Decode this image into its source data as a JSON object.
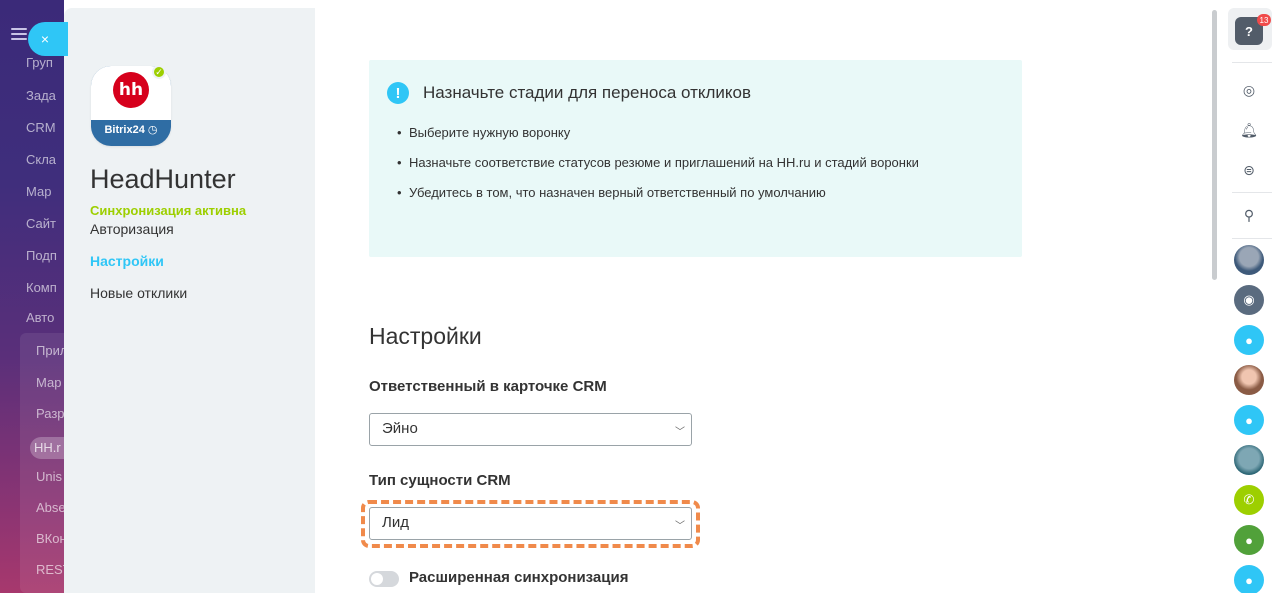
{
  "portal_menu": {
    "items": [
      {
        "label": "Груп",
        "active": false
      },
      {
        "label": "Зада",
        "active": false
      },
      {
        "label": "CRM",
        "active": false
      },
      {
        "label": "Скла",
        "active": false
      },
      {
        "label": "Мар",
        "active": false
      },
      {
        "label": "Сайт",
        "active": false
      },
      {
        "label": "Подп",
        "active": false
      },
      {
        "label": "Комп",
        "active": false
      },
      {
        "label": "Авто",
        "active": false
      },
      {
        "label": "Прил",
        "active": false
      },
      {
        "label": "Мар",
        "active": false
      },
      {
        "label": "Разр",
        "active": false
      },
      {
        "label": "HH.r",
        "active": true
      },
      {
        "label": "Unis",
        "active": false
      },
      {
        "label": "Abse",
        "active": false
      },
      {
        "label": "ВКон",
        "active": false
      },
      {
        "label": "REST",
        "active": false
      }
    ]
  },
  "slider": {
    "close_icon": "×"
  },
  "app_nav": {
    "logo_text": "hh",
    "logo_brand": "Bitrix24",
    "app_title": "HeadHunter",
    "sync_status": "Синхронизация активна",
    "links": [
      {
        "label": "Авторизация",
        "active": false
      },
      {
        "label": "Настройки",
        "active": true
      },
      {
        "label": "Новые отклики",
        "active": false
      }
    ]
  },
  "notice": {
    "icon": "!",
    "title": "Назначьте стадии для переноса откликов",
    "bullets": [
      "Выберите нужную воронку",
      "Назначьте соответствие статусов резюме и приглашений на HH.ru и стадий воронки",
      "Убедитесь в том, что назначен верный ответственный по умолчанию"
    ]
  },
  "settings": {
    "title": "Настройки",
    "responsible_label": "Ответственный в карточке CRM",
    "responsible_value": "Эйно",
    "entity_label": "Тип сущности CRM",
    "entity_value": "Лид",
    "advanced_sync_label": "Расширенная синхронизация",
    "advanced_sync_enabled": false
  },
  "right_rail": {
    "help_label": "?",
    "notifications_count": "13",
    "icons": [
      "history-icon",
      "bell-icon",
      "chat-icon",
      "search-icon"
    ],
    "accent_highlight": "#f08a4b"
  }
}
